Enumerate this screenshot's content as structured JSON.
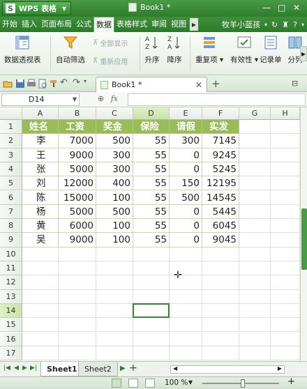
{
  "app": {
    "name": "WPS 表格",
    "doc_title": "Book1 *"
  },
  "menu": {
    "items": [
      "开始",
      "插入",
      "页面布局",
      "公式",
      "数据",
      "表格样式",
      "审阅",
      "视图"
    ],
    "active": "数据",
    "user": "牧羊小蓝孩"
  },
  "ribbon": {
    "pivot": "数据透视表",
    "autofilter": "自动筛选",
    "show_all": "全部显示",
    "reapply": "重新应用",
    "sort_asc": "升序",
    "sort_desc": "降序",
    "duplicates": "重复项",
    "validity": "有效性",
    "record": "记录单",
    "split": "分列"
  },
  "tab": {
    "label": "Book1 *"
  },
  "formula_bar": {
    "name_box": "D14",
    "fx": "fx",
    "value": ""
  },
  "columns": [
    "A",
    "B",
    "C",
    "D",
    "E",
    "F",
    "G",
    "H"
  ],
  "rows": [
    "1",
    "2",
    "3",
    "4",
    "5",
    "6",
    "7",
    "8",
    "9",
    "10",
    "11",
    "12",
    "13",
    "14",
    "15",
    "16",
    "17"
  ],
  "table": {
    "headers": [
      "姓名",
      "工资",
      "奖金",
      "保险",
      "请假",
      "实发"
    ],
    "rows": [
      [
        "李",
        "7000",
        "500",
        "55",
        "300",
        "7145"
      ],
      [
        "王",
        "9000",
        "300",
        "55",
        "0",
        "9245"
      ],
      [
        "张",
        "5000",
        "300",
        "55",
        "0",
        "5245"
      ],
      [
        "刘",
        "12000",
        "400",
        "55",
        "150",
        "12195"
      ],
      [
        "陈",
        "15000",
        "100",
        "55",
        "500",
        "14545"
      ],
      [
        "杨",
        "5000",
        "500",
        "55",
        "0",
        "5445"
      ],
      [
        "黄",
        "6000",
        "100",
        "55",
        "0",
        "6045"
      ],
      [
        "吴",
        "9000",
        "100",
        "55",
        "0",
        "9045"
      ]
    ]
  },
  "sheets": [
    "Sheet1",
    "Sheet2"
  ],
  "active_sheet": "Sheet1",
  "status": {
    "zoom": "100 %"
  },
  "colors": {
    "accent": "#2f8a2c",
    "table_header": "#9bbb59",
    "selection": "#c9e3a6"
  }
}
